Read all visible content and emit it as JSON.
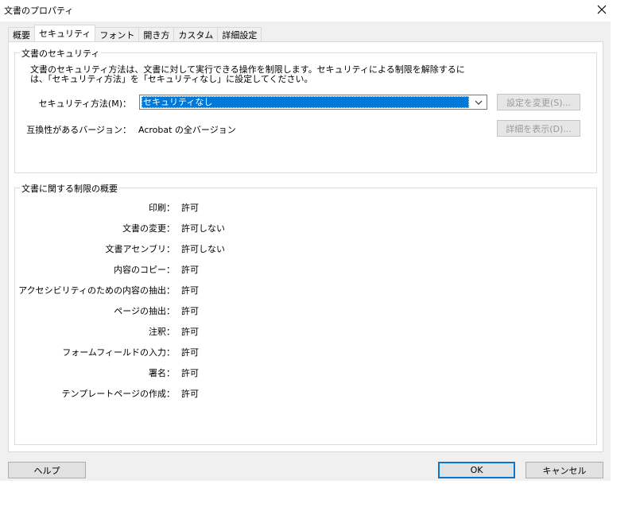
{
  "window": {
    "title": "文書のプロパティ",
    "close_icon": "close-icon"
  },
  "tabs": [
    {
      "label": "概要",
      "active": false
    },
    {
      "label": "セキュリティ",
      "active": true
    },
    {
      "label": "フォント",
      "active": false
    },
    {
      "label": "開き方",
      "active": false
    },
    {
      "label": "カスタム",
      "active": false
    },
    {
      "label": "詳細設定",
      "active": false
    }
  ],
  "security_group": {
    "legend": "文書のセキュリティ",
    "description_line1": "文書のセキュリティ方法は、文書に対して実行できる操作を制限します。セキュリティによる制限を解除するに",
    "description_line2": "は、「セキュリティ方法」を「セキュリティなし」に設定してください。",
    "method_label": "セキュリティ方法(M)：",
    "method_value": "セキュリティなし",
    "change_settings_button": "設定を変更(S)...",
    "compat_label": "互換性があるバージョン：",
    "compat_value": "Acrobat の全バージョン",
    "show_details_button": "詳細を表示(D)..."
  },
  "restrictions_group": {
    "legend": "文書に関する制限の概要",
    "items": [
      {
        "label": "印刷：",
        "value": "許可"
      },
      {
        "label": "文書の変更：",
        "value": "許可しない"
      },
      {
        "label": "文書アセンブリ：",
        "value": "許可しない"
      },
      {
        "label": "内容のコピー：",
        "value": "許可"
      },
      {
        "label": "アクセシビリティのための内容の抽出：",
        "value": "許可"
      },
      {
        "label": "ページの抽出：",
        "value": "許可"
      },
      {
        "label": "注釈：",
        "value": "許可"
      },
      {
        "label": "フォームフィールドの入力：",
        "value": "許可"
      },
      {
        "label": "署名：",
        "value": "許可"
      },
      {
        "label": "テンプレートページの作成：",
        "value": "許可"
      }
    ]
  },
  "footer": {
    "help_button": "ヘルプ",
    "ok_button": "OK",
    "cancel_button": "キャンセル"
  },
  "colors": {
    "accent": "#0078d7",
    "dialog_bg": "#f0f0f0"
  }
}
